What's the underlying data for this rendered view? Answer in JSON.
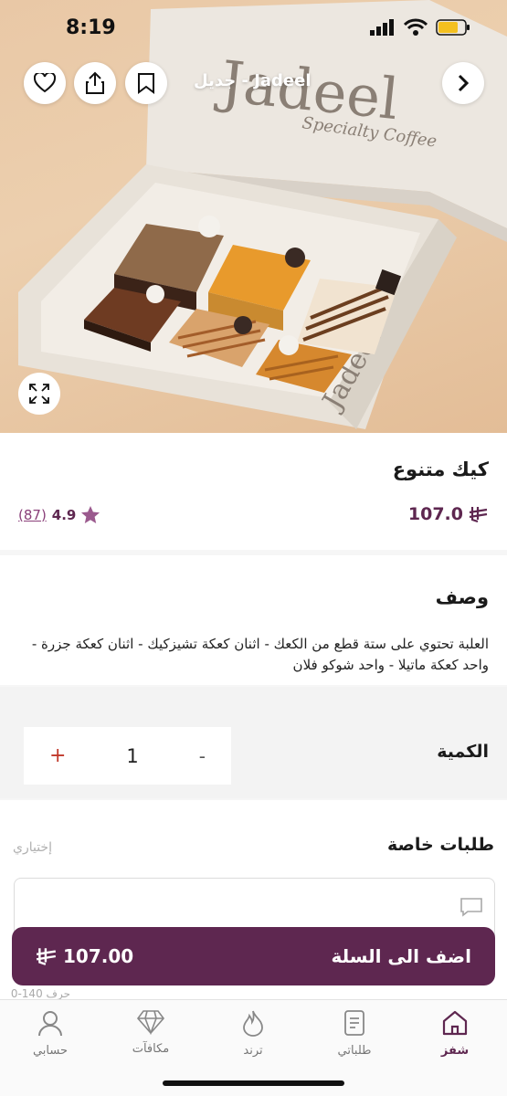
{
  "status_bar": {
    "time": "8:19"
  },
  "header": {
    "title": "Jadeel - جديل"
  },
  "hero": {
    "box_brand": "Jadeel",
    "box_subtitle": "Specialty Coffee",
    "cake_tag": "Jadeel"
  },
  "product": {
    "name": "كيك متنوع",
    "price": "107.0",
    "rating": "4.9",
    "rating_count": "(87)"
  },
  "description": {
    "title": "وصف",
    "text": "العلبة تحتوي على ستة قطع من الكعك - اثنان كعكة تشيزكيك - اثنان كعكة جزرة - واحد كعكة ماتيلا - واحد شوكو فلان"
  },
  "quantity": {
    "label": "الكمية",
    "value": "1",
    "plus": "+",
    "minus": "-"
  },
  "special_requests": {
    "title": "طلبات خاصة",
    "optional_label": "إختياري",
    "counter": "0-140 حرف"
  },
  "cart_button": {
    "label": "اضف الى السلة",
    "total": "107.00"
  },
  "bottom_nav": [
    {
      "label": "شفز",
      "icon": "home-icon",
      "active": true
    },
    {
      "label": "طلباتي",
      "icon": "orders-icon",
      "active": false
    },
    {
      "label": "ترند",
      "icon": "flame-icon",
      "active": false
    },
    {
      "label": "مكافآت",
      "icon": "diamond-icon",
      "active": false
    },
    {
      "label": "حسابي",
      "icon": "user-icon",
      "active": false
    }
  ],
  "colors": {
    "brand": "#5e2750",
    "accent_red": "#c0392b",
    "star": "#9b5a8e"
  }
}
